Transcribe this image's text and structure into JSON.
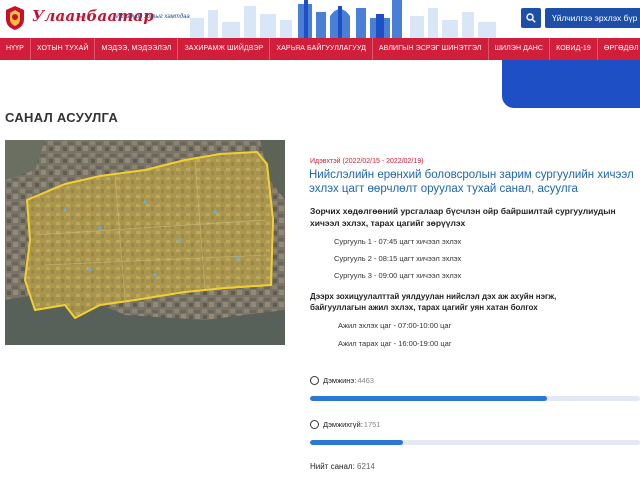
{
  "header": {
    "logo_text": "Улаанбаатар",
    "tagline": "Ирээдүйн хотыг хамтдаа",
    "search_label": "Үйлчилгээ эрхлэх бүр"
  },
  "nav": {
    "items": [
      "НҮҮР",
      "ХОТЫН ТУХАЙ",
      "МЭДЭЭ, МЭДЭЭЛЭЛ",
      "ЗАХИРАМЖ ШИЙДВЭР",
      "ХАРЬЯА БАЙГУУЛЛАГУУД",
      "АВЛИГЫН ЭСРЭГ ШИНЭТГЭЛ",
      "ШИЛЭН ДАНС",
      "КОВИД-19",
      "ӨРГӨДӨЛ ГОМДОЛ"
    ]
  },
  "page": {
    "title": "САНАЛ АСУУЛГА"
  },
  "poll": {
    "status": "Идэвхтэй (2022/02/15 - 2022/02/19)",
    "title_line1": "Нийслэлийн ерөнхий боловсролын зарим сургуулийн хичээл",
    "title_line2": "эхлэх цагт өөрчлөлт оруулах тухай санал, асуулга",
    "question_line1": "Зорчих хөдөлгөөний урсгалаар бүсчлэн ойр байршилтай сургуулиудын",
    "question_line2": "хичээл эхлэх, тарах цагийг зөрүүлэх",
    "options": [
      "Сургууль 1 - 07:45 цагт хичээл эхлэх",
      "Сургууль 2 - 08:15 цагт хичээл эхлэх",
      "Сургууль 3 - 09:00 цагт хичээл эхлэх"
    ],
    "question2_line1": "Дээрх зохицуулалттай уялдуулан нийслэл дэх аж ахуйн нэгж,",
    "question2_line2": "байгууллагын ажил эхлэх, тарах цагийг уян хатан болгох",
    "work_start": "Ажил эхлэх цаг - 07:00-10:00 цаг",
    "work_end": "Ажил тарах цаг - 16:00-19:00 цаг",
    "votes": [
      {
        "label": "Дэмжинэ:",
        "count": "4463",
        "share": 0.718
      },
      {
        "label": "Дэмжихгүй:",
        "count": "1751",
        "share": 0.282
      }
    ],
    "total_label": "Нийт санал:",
    "total_count": "6214"
  },
  "colors": {
    "brand_red": "#d11e3b",
    "brand_blue": "#1d4ea8",
    "link_blue": "#1d66b0",
    "bar_blue": "#2a78d3"
  }
}
